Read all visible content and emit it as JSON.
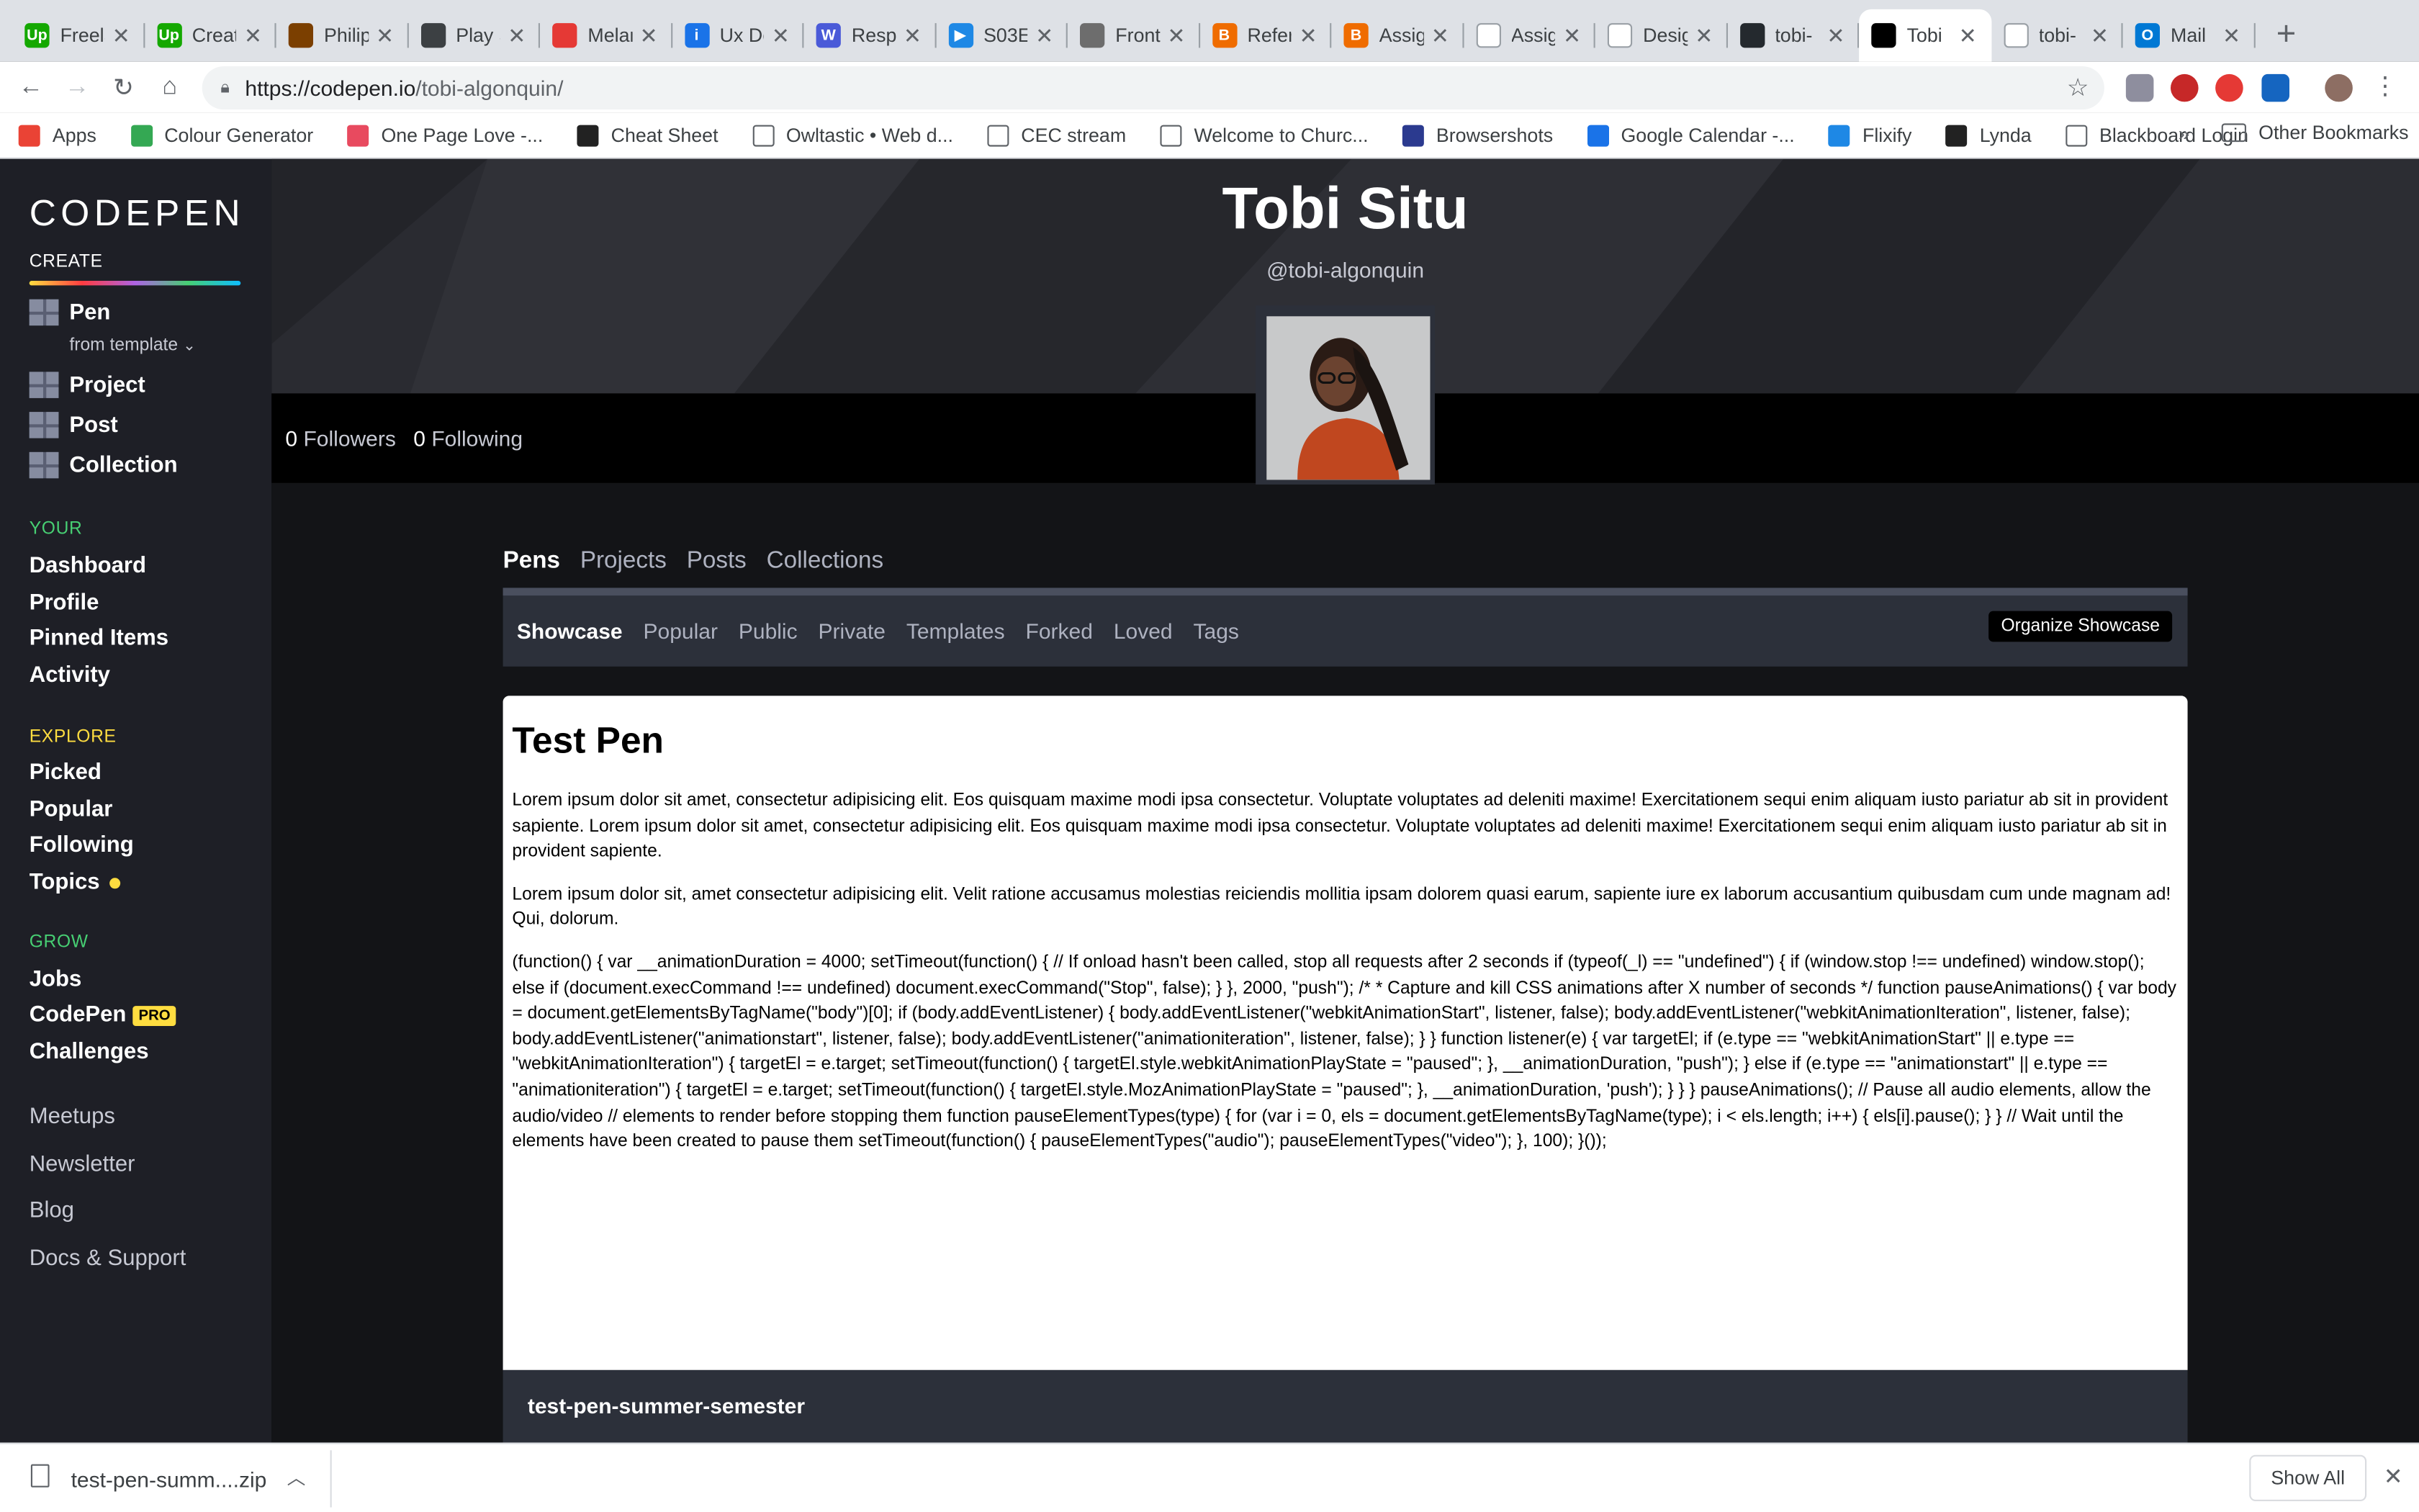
{
  "browser": {
    "tabs": [
      {
        "title": "Freelance",
        "color": "#14a800",
        "glyph": "Up"
      },
      {
        "title": "Create",
        "color": "#14a800",
        "glyph": "Up"
      },
      {
        "title": "Philip",
        "color": "#7b3f00",
        "glyph": ""
      },
      {
        "title": "Play S",
        "color": "#3c4043",
        "glyph": ""
      },
      {
        "title": "Melanin",
        "color": "#e53935",
        "glyph": ""
      },
      {
        "title": "Ux De",
        "color": "#1a73e8",
        "glyph": "i"
      },
      {
        "title": "Resp",
        "color": "#4a5ad8",
        "glyph": "W"
      },
      {
        "title": "S03E",
        "color": "#1e88e5",
        "glyph": "▶"
      },
      {
        "title": "Front",
        "color": "#6d6d6d",
        "glyph": ""
      },
      {
        "title": "Refer",
        "color": "#ef6c00",
        "glyph": "B"
      },
      {
        "title": "Assig",
        "color": "#ef6c00",
        "glyph": "B"
      },
      {
        "title": "Assig",
        "color": "#ffffff",
        "glyph": ""
      },
      {
        "title": "Desig",
        "color": "#ffffff",
        "glyph": ""
      },
      {
        "title": "tobi-",
        "color": "#24292e",
        "glyph": ""
      },
      {
        "title": "Tobi",
        "color": "#000000",
        "glyph": ""
      },
      {
        "title": "tobi-",
        "color": "#ffffff",
        "glyph": ""
      },
      {
        "title": "Mail",
        "color": "#0078d4",
        "glyph": "O"
      }
    ],
    "active_tab_index": 14,
    "url_host": "https://codepen.io",
    "url_path": "/tobi-algonquin/",
    "bookmarks": [
      {
        "label": "Apps",
        "color": "#ea4335"
      },
      {
        "label": "Colour Generator",
        "color": "#34a853"
      },
      {
        "label": "One Page Love -...",
        "color": "#e84a5f"
      },
      {
        "label": "Cheat Sheet",
        "color": "#222222"
      },
      {
        "label": "Owltastic • Web d...",
        "color": "#ffffff"
      },
      {
        "label": "CEC stream",
        "color": "#ffffff"
      },
      {
        "label": "Welcome to Churc...",
        "color": "#ffffff"
      },
      {
        "label": "Browsershots",
        "color": "#2b3a8f"
      },
      {
        "label": "Google Calendar -...",
        "color": "#1a73e8"
      },
      {
        "label": "Flixify",
        "color": "#1e88e5"
      },
      {
        "label": "Lynda",
        "color": "#222222"
      },
      {
        "label": "Blackboard Login",
        "color": "#ffffff"
      }
    ],
    "bookmarks_more": "»",
    "other_bookmarks": "Other Bookmarks"
  },
  "sidebar": {
    "logo": "CODEPEN",
    "create_label": "CREATE",
    "create_items": [
      "Pen",
      "Project",
      "Post",
      "Collection"
    ],
    "from_template": "from template",
    "your_label": "YOUR",
    "your_items": [
      "Dashboard",
      "Profile",
      "Pinned Items",
      "Activity"
    ],
    "explore_label": "EXPLORE",
    "explore_items": [
      "Picked",
      "Popular",
      "Following",
      "Topics"
    ],
    "grow_label": "GROW",
    "grow_items": [
      "Jobs",
      "CodePen",
      "Challenges"
    ],
    "pro_badge": "PRO",
    "footer_items": [
      "Meetups",
      "Newsletter",
      "Blog",
      "Docs & Support"
    ],
    "colors": {
      "create": "#ffffff",
      "your": "#47cf73",
      "explore": "#ffdd40",
      "grow": "#47cf73"
    }
  },
  "profile": {
    "name": "Tobi Situ",
    "handle": "@tobi-algonquin",
    "followers_count": "0",
    "followers_label": "Followers",
    "following_count": "0",
    "following_label": "Following"
  },
  "tabs": {
    "primary": [
      "Pens",
      "Projects",
      "Posts",
      "Collections"
    ],
    "secondary": [
      "Showcase",
      "Popular",
      "Public",
      "Private",
      "Templates",
      "Forked",
      "Loved",
      "Tags"
    ],
    "organize_button": "Organize Showcase"
  },
  "pen": {
    "title": "Test Pen",
    "paragraphs": [
      "Lorem ipsum dolor sit amet, consectetur adipisicing elit. Eos quisquam maxime modi ipsa consectetur. Voluptate voluptates ad deleniti maxime! Exercitationem sequi enim aliquam iusto pariatur ab sit in provident sapiente. Lorem ipsum dolor sit amet, consectetur adipisicing elit. Eos quisquam maxime modi ipsa consectetur. Voluptate voluptates ad deleniti maxime! Exercitationem sequi enim aliquam iusto pariatur ab sit in provident sapiente.",
      "Lorem ipsum dolor sit, amet consectetur adipisicing elit. Velit ratione accusamus molestias reiciendis mollitia ipsam dolorem quasi earum, sapiente iure ex laborum accusantium quibusdam cum unde magnam ad! Qui, dolorum.",
      "(function() { var __animationDuration = 4000; setTimeout(function() { // If onload hasn't been called, stop all requests after 2 seconds if (typeof(_l) == \"undefined\") { if (window.stop !== undefined) window.stop(); else if (document.execCommand !== undefined) document.execCommand(\"Stop\", false); } }, 2000, \"push\"); /* * Capture and kill CSS animations after X number of seconds */ function pauseAnimations() { var body = document.getElementsByTagName(\"body\")[0]; if (body.addEventListener) { body.addEventListener(\"webkitAnimationStart\", listener, false); body.addEventListener(\"webkitAnimationIteration\", listener, false); body.addEventListener(\"animationstart\", listener, false); body.addEventListener(\"animationiteration\", listener, false); } } function listener(e) { var targetEl; if (e.type == \"webkitAnimationStart\" || e.type == \"webkitAnimationIteration\") { targetEl = e.target; setTimeout(function() { targetEl.style.webkitAnimationPlayState = \"paused\"; }, __animationDuration, \"push\"); } else if (e.type == \"animationstart\" || e.type == \"animationiteration\") { targetEl = e.target; setTimeout(function() { targetEl.style.MozAnimationPlayState = \"paused\"; }, __animationDuration, 'push'); } } } pauseAnimations(); // Pause all audio elements, allow the audio/video // elements to render before stopping them function pauseElementTypes(type) { for (var i = 0, els = document.getElementsByTagName(type); i < els.length; i++) { els[i].pause(); } } // Wait until the elements have been created to pause them setTimeout(function() { pauseElementTypes(\"audio\"); pauseElementTypes(\"video\"); }, 100); }());"
    ],
    "footer_title": "test-pen-summer-semester"
  },
  "download": {
    "filename": "test-pen-summ....zip",
    "show_all": "Show All"
  }
}
